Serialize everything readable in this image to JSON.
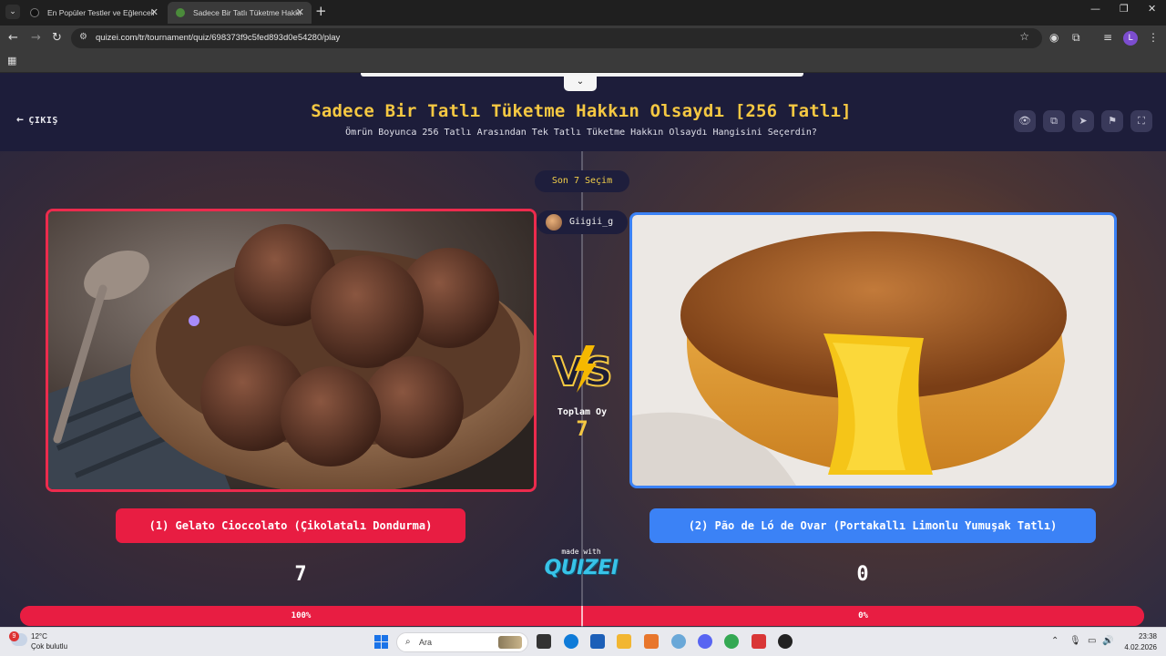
{
  "browser": {
    "tabs": [
      {
        "label": "En Popüler Testler ve Eğlenceli"
      },
      {
        "label": "Sadece Bir Tatlı Tüketme Hakkı"
      }
    ],
    "url": "quizei.com/tr/tournament/quiz/698373f9c5fed893d0e54280/play",
    "profile_initial": "L"
  },
  "page": {
    "exit_label": "ÇIKIŞ",
    "title": "Sadece Bir Tatlı Tüketme Hakkın Olsaydı [256 Tatlı]",
    "subtitle": "Ömrün Boyunca 256 Tatlı Arasından Tek Tatlı Tüketme Hakkın Olsaydı Hangisini Seçerdin?",
    "header_icons": [
      "eye-icon",
      "share-icon",
      "send-icon",
      "flag-icon",
      "fullscreen-icon"
    ],
    "last_choices_label": "Son 7 Seçim",
    "username": "Giigii_g",
    "total_votes_label": "Toplam Oy",
    "total_votes": "7",
    "made_with": "made with",
    "brand": "QUIZEI"
  },
  "options": [
    {
      "label": "(1) Gelato Cioccolato (Çikolatalı Dondurma)",
      "votes": "7",
      "percent_text": "100%",
      "percent": 100,
      "color": "#e81d42"
    },
    {
      "label": "(2) Pão de Ló de Ovar (Portakallı Limonlu Yumuşak Tatlı)",
      "votes": "0",
      "percent_text": "0%",
      "percent": 0,
      "color": "#3b82f6"
    }
  ],
  "taskbar": {
    "weather_temp": "12°C",
    "weather_condition": "Çok bulutlu",
    "notification_count": "9",
    "search_placeholder": "Ara",
    "time": "23:38",
    "date": "4.02.2026"
  },
  "colors": {
    "accent_yellow": "#f5c842",
    "left_red": "#e81d42",
    "right_blue": "#3b82f6"
  }
}
